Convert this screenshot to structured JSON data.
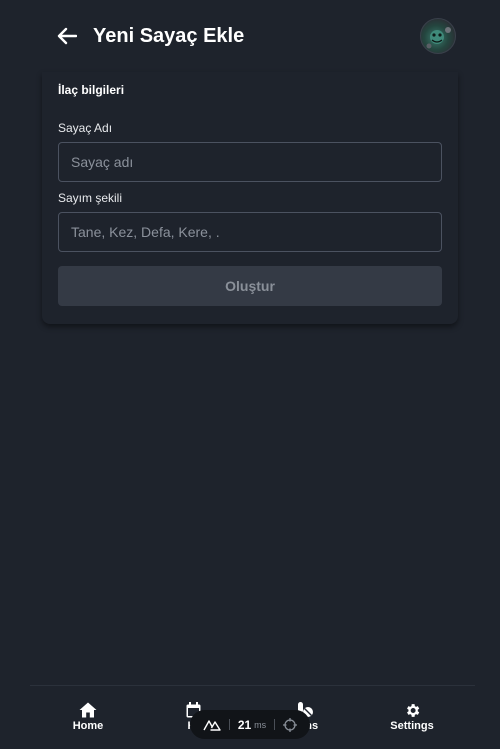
{
  "header": {
    "title": "Yeni Sayaç Ekle"
  },
  "form": {
    "section_title": "İlaç bilgileri",
    "counter_name": {
      "label": "Sayaç Adı",
      "placeholder": "Sayaç adı",
      "value": ""
    },
    "count_type": {
      "label": "Sayım şekili",
      "placeholder": "Tane, Kez, Defa, Kere, .",
      "value": ""
    },
    "submit_label": "Oluştur"
  },
  "nav": {
    "items": [
      {
        "label": "Home",
        "icon": "home-icon"
      },
      {
        "label": "Hi",
        "icon": "calendar-icon"
      },
      {
        "label": "tions",
        "icon": "pills-icon"
      },
      {
        "label": "Settings",
        "icon": "gear-icon"
      }
    ]
  },
  "dev_overlay": {
    "render_time": "21",
    "unit": "ms"
  },
  "colors": {
    "background": "#1e232c",
    "input_border": "#4b5260",
    "button_disabled_bg": "#343a45",
    "button_disabled_text": "#8a9099"
  }
}
